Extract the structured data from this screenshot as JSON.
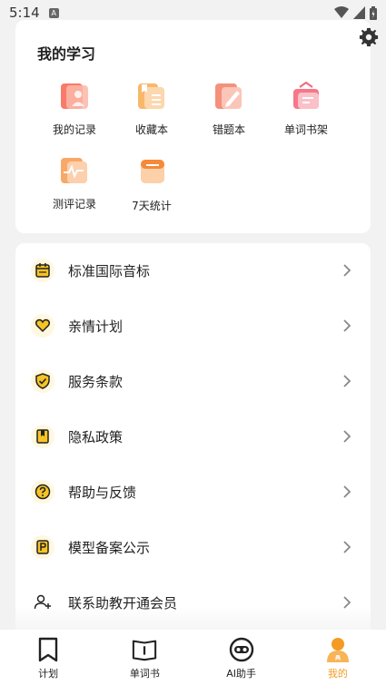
{
  "status_bar": {
    "time": "5:14",
    "notif_glyph": "A"
  },
  "study": {
    "title": "我的学习",
    "items": [
      {
        "label": "我的记录"
      },
      {
        "label": "收藏本"
      },
      {
        "label": "错题本"
      },
      {
        "label": "单词书架"
      },
      {
        "label": "测评记录"
      },
      {
        "label": "7天统计"
      }
    ]
  },
  "menu": {
    "items": [
      {
        "label": "标准国际音标",
        "icon": "calendar-icon"
      },
      {
        "label": "亲情计划",
        "icon": "heart-icon"
      },
      {
        "label": "服务条款",
        "icon": "shield-check-icon"
      },
      {
        "label": "隐私政策",
        "icon": "bookmark-doc-icon"
      },
      {
        "label": "帮助与反馈",
        "icon": "question-icon"
      },
      {
        "label": "模型备案公示",
        "icon": "p-badge-icon"
      },
      {
        "label": "联系助教开通会员",
        "icon": "add-user-icon"
      }
    ]
  },
  "tabs": [
    {
      "label": "计划",
      "icon": "bookmark-icon"
    },
    {
      "label": "单词书",
      "icon": "book-icon"
    },
    {
      "label": "AI助手",
      "icon": "robot-icon"
    },
    {
      "label": "我的",
      "icon": "profile-icon",
      "active": true
    }
  ],
  "colors": {
    "accent": "#f59a23",
    "icon_bg": "#fff7df",
    "icon_yellow": "#f7c325"
  }
}
